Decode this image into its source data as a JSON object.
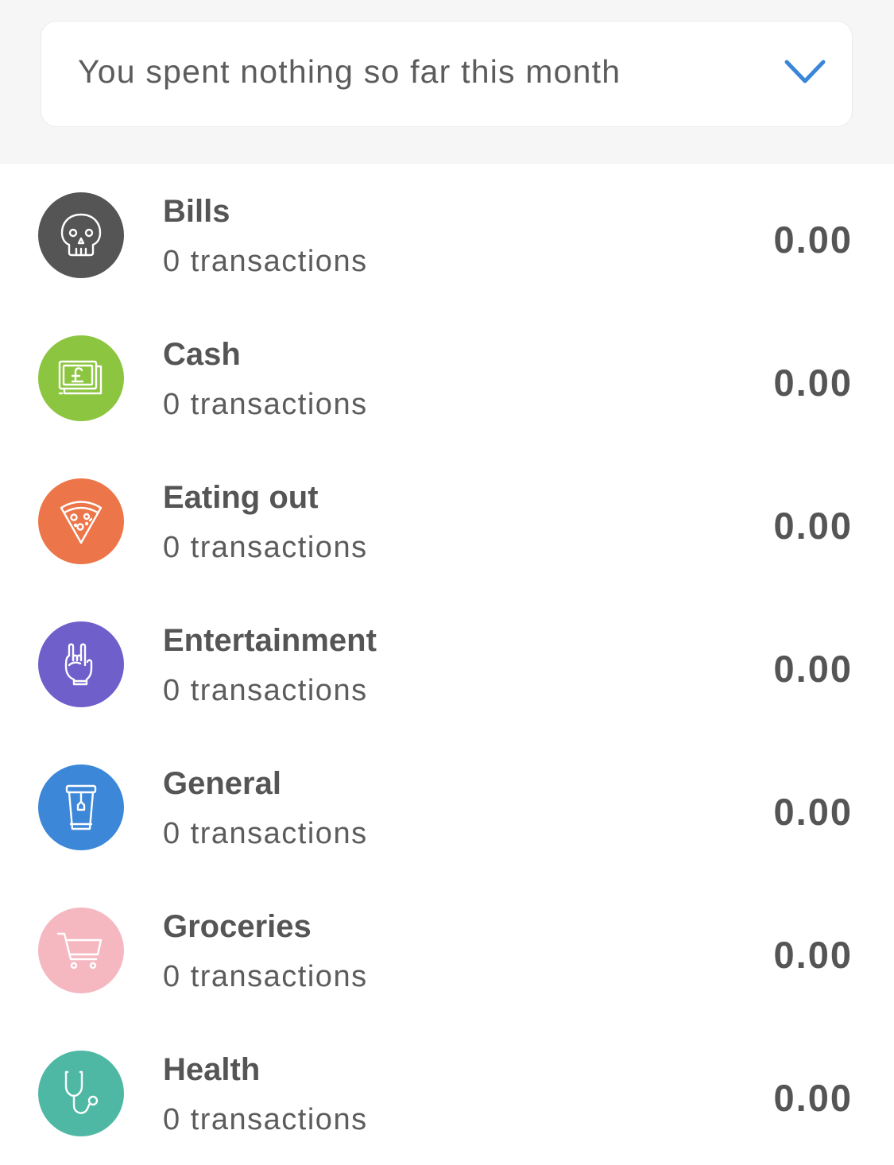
{
  "summary": {
    "text": "You spent nothing so far this month",
    "chevron_icon": "chevron-down-icon",
    "chevron_color": "#3a86d9"
  },
  "categories": [
    {
      "name": "Bills",
      "count": "0 transactions",
      "amount": "0.00",
      "icon": "skull-icon",
      "color": "#555555"
    },
    {
      "name": "Cash",
      "count": "0 transactions",
      "amount": "0.00",
      "icon": "banknote-pound-icon",
      "color": "#8cc53f"
    },
    {
      "name": "Eating out",
      "count": "0 transactions",
      "amount": "0.00",
      "icon": "pizza-slice-icon",
      "color": "#ec7649"
    },
    {
      "name": "Entertainment",
      "count": "0 transactions",
      "amount": "0.00",
      "icon": "rock-hand-icon",
      "color": "#6e5fcb"
    },
    {
      "name": "General",
      "count": "0 transactions",
      "amount": "0.00",
      "icon": "cup-icon",
      "color": "#3d87d9"
    },
    {
      "name": "Groceries",
      "count": "0 transactions",
      "amount": "0.00",
      "icon": "shopping-cart-icon",
      "color": "#f5b8c1"
    },
    {
      "name": "Health",
      "count": "0 transactions",
      "amount": "0.00",
      "icon": "stethoscope-icon",
      "color": "#4fb8a5"
    }
  ]
}
